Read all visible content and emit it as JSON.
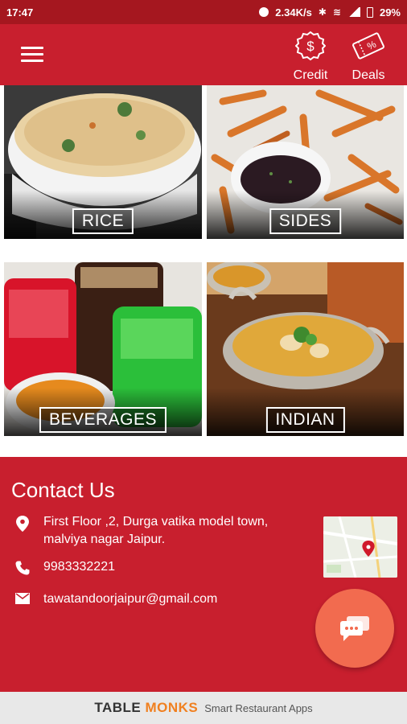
{
  "status_bar": {
    "time": "17:47",
    "network_speed": "2.34K/s",
    "battery": "29%"
  },
  "app_bar": {
    "credit_label": "Credit",
    "deals_label": "Deals"
  },
  "categories": [
    {
      "label": "RICE"
    },
    {
      "label": "SIDES"
    },
    {
      "label": "BEVERAGES"
    },
    {
      "label": "INDIAN"
    }
  ],
  "contact": {
    "title": "Contact Us",
    "address_line1": "First Floor ,2, Durga vatika model town,",
    "address_line2": "malviya nagar Jaipur.",
    "phone": "9983332221",
    "email": "tawatandoorjaipur@gmail.com"
  },
  "footer": {
    "brand_part1": "TABLE",
    "brand_part2": "MONKS",
    "tagline": "Smart Restaurant Apps"
  },
  "colors": {
    "primary": "#c81f2e",
    "status_bar": "#a5171f",
    "fab": "#f26b4f",
    "brand_orange": "#f08020"
  }
}
